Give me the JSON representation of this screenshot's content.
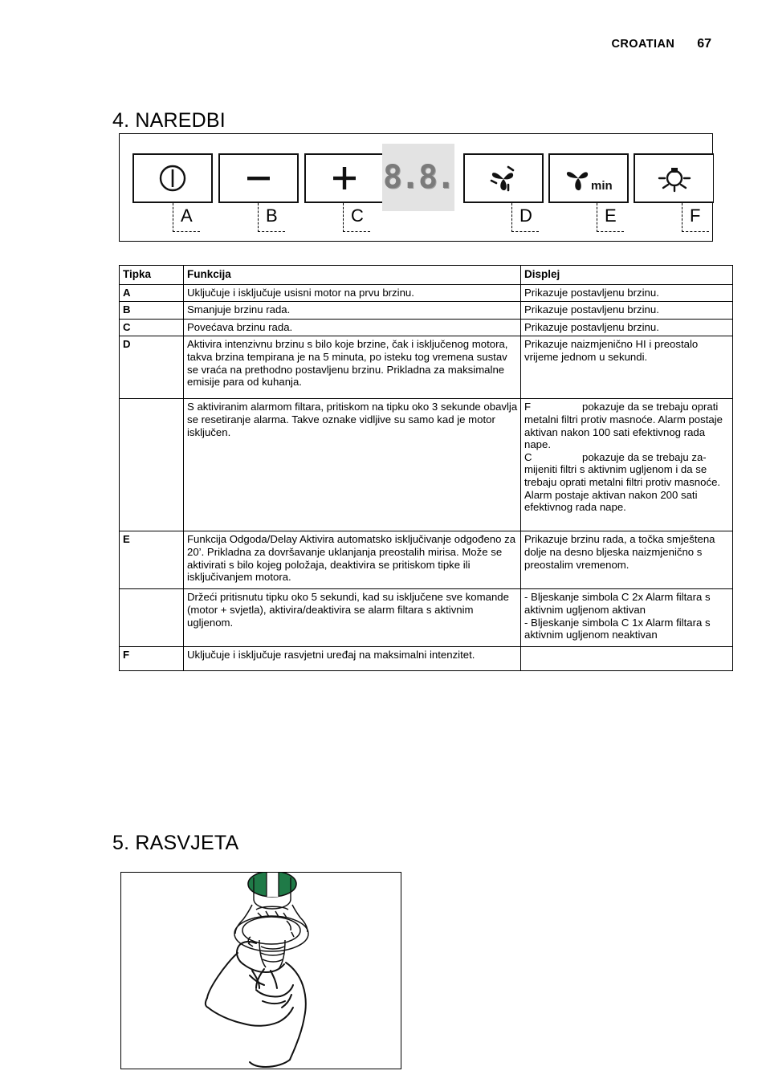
{
  "header": {
    "language": "CROATIAN",
    "page_number": "67"
  },
  "sections": {
    "commands_title": "4. NAREDBI",
    "lighting_title": "5. RASVJETA"
  },
  "control_panel": {
    "display_value": "8.8.",
    "keys": [
      {
        "id": "A",
        "icon": "power-icon",
        "label": "A"
      },
      {
        "id": "B",
        "icon": "minus-icon",
        "label": "B"
      },
      {
        "id": "C",
        "icon": "plus-icon",
        "label": "C"
      },
      {
        "id": "D",
        "icon": "fan-intensive-icon",
        "label": "D"
      },
      {
        "id": "E",
        "icon": "fan-min-timer-icon",
        "label": "E"
      },
      {
        "id": "F",
        "icon": "lamp-icon",
        "label": "F"
      }
    ],
    "min_label": "min"
  },
  "table": {
    "headers": {
      "key": "Tipka",
      "function": "Funkcija",
      "display": "Displej"
    },
    "rows": [
      {
        "key": "A",
        "function": "Uključuje i isključuje usisni motor na prvu brzinu.",
        "display": "Prikazuje postavljenu brzinu."
      },
      {
        "key": "B",
        "function": "Smanjuje brzinu rada.",
        "display": "Prikazuje postavljenu brzinu."
      },
      {
        "key": "C",
        "function": "Povećava brzinu rada.",
        "display": "Prikazuje postavljenu brzinu."
      },
      {
        "key": "D",
        "function": "Aktivira intenzivnu brzinu s bilo koje brzine, čak i isključenog motora, takva brzina tempirana je na 5 minuta, po isteku tog vremena sustav se vraća na prethodno postavljenu brzinu. Prikladna za maksimalne emisije para od kuhanja.",
        "display": "Prikazuje naizmjenično HI i preostalo vrijeme jednom u sekundi."
      },
      {
        "key": "",
        "function": "S aktiviranim alarmom filtara, pritiskom na tipku oko 3 sekunde obavlja se resetiranje alarma. Takve oznake vidljive su samo kad je motor isključen.",
        "display_blocks": [
          {
            "tag": "F",
            "text": "pokazuje da se trebaju oprati metalni filtri protiv masnoće. Alarm postaje aktivan nakon 100 sati efektivnog rada nape."
          },
          {
            "tag": "C",
            "text": "pokazuje da se trebaju za-mijeniti filtri s aktivnim ugljenom i da se trebaju oprati metalni filtri protiv masnoće. Alarm postaje aktivan nakon 200 sati efektivnog rada nape."
          }
        ]
      },
      {
        "key": "E",
        "function": " Funkcija Odgoda/Delay Aktivira automatsko isključivanje odgođeno za 20’. Prikladna za dovršavanje uklanjanja preostalih mirisa. Može se aktivirati s bilo kojeg položaja, deaktivira se pritiskom tipke ili isključivanjem motora.",
        "display": "Prikazuje brzinu rada, a točka smještena dolje na desno bljeska naizmjenično s preostalim vremenom."
      },
      {
        "key": "",
        "function": "Držeći pritisnutu tipku oko 5 sekundi, kad su isključene sve komande (motor + svjetla), aktivira/deaktivira se alarm filtara s aktivnim ugljenom.",
        "display_lines": [
          "- Bljeskanje simbola C 2x  Alarm filtara s aktivnim ugljenom aktivan",
          "- Bljeskanje simbola C 1x Alarm filtara s aktivnim ugljenom neaktivan"
        ]
      },
      {
        "key": "F",
        "function": "Uključuje i isključuje rasvjetni uređaj na maksimalni intenzitet.",
        "display": ""
      }
    ]
  },
  "figure": {
    "name": "hand-replacing-lamp-illustration",
    "lamp_cap_color": "#1f7a47"
  }
}
